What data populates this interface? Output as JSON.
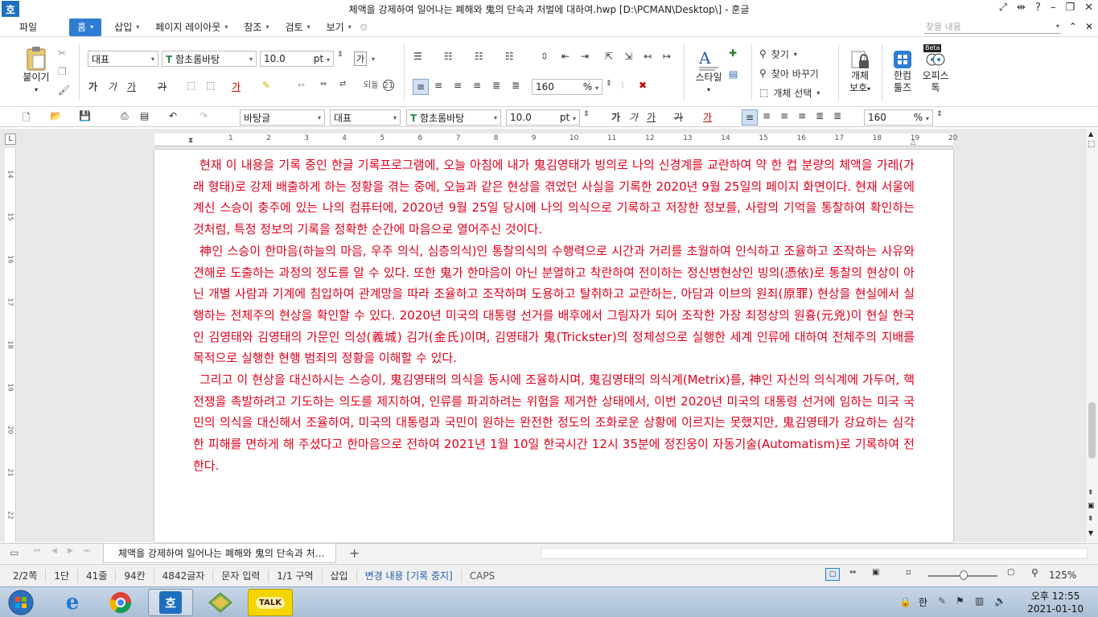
{
  "app": {
    "logo": "호",
    "title": "체액을 강제하여 일어나는 폐해와 鬼의 단속과 처벌에 대하여.hwp [D:\\PCMAN\\Desktop\\] - 훈글"
  },
  "menu": {
    "items": [
      "파일",
      "홈",
      "삽입",
      "페이지 레이아웃",
      "참조",
      "검토",
      "보기"
    ],
    "search_placeholder": "찾을 내용"
  },
  "ribbon": {
    "paste_label": "붙이기",
    "style_combo": "대표",
    "font_combo": "함초롬바탕",
    "size_combo": "10.0",
    "size_unit": "pt",
    "bold": "가",
    "italic": "가",
    "underline": "가",
    "strike": "가",
    "font_color": "가",
    "size_zoom": "160",
    "zoom_unit": "%",
    "style_label": "스타일",
    "find_label": "찾기",
    "replace_label": "찾아 바꾸기",
    "select_obj_label": "개체 선택",
    "protect_label_1": "개체",
    "protect_label_2": "보호",
    "hancom_tools_1": "한컴",
    "hancom_tools_2": "툴즈",
    "office_tok_1": "오피스",
    "office_tok_2": "톡",
    "beta_badge": "Beta",
    "para_combo_left": "가",
    "char_reset": "되돌",
    "char_count_circ": "21"
  },
  "toolbar2": {
    "para_style": "바탕글",
    "style": "대표",
    "font": "함초롬바탕",
    "size": "10.0",
    "size_unit": "pt",
    "zoom": "160",
    "zoom_unit": "%",
    "bold": "가",
    "italic": "가",
    "underline": "가",
    "strike": "가",
    "color": "가"
  },
  "ruler": {
    "numbers": [
      "1",
      "2",
      "3",
      "4",
      "5",
      "6",
      "7",
      "8",
      "9",
      "10",
      "11",
      "12",
      "13",
      "14",
      "15",
      "16",
      "17",
      "18",
      "19",
      "20"
    ],
    "vnumbers": [
      "14",
      "15",
      "16",
      "17",
      "18",
      "19",
      "20",
      "21",
      "22",
      "23"
    ]
  },
  "document": {
    "paragraphs": [
      "현재 이 내용을 기록 중인 한글 기록프로그램에, 오늘 아침에 내가 鬼김영태가 빙의로 나의 신경계를 교란하여 약 한 컵 분량의 체액을 가레(가래 형태)로 강제 배출하게 하는 정황을 겪는 중에, 오늘과 같은 현상을 겪었던 사실을 기록한 2020년 9월 25일의 페이지 화면이다. 현재 서울에 계신 스승이 충주에 있는 나의 컴퓨터에, 2020년 9월 25일 당시에 나의 의식으로 기록하고 저장한 정보를, 사람의 기억을 통찰하여 확인하는 것처럼, 특정 정보의 기록을 정확한 순간에 마음으로 열어주신 것이다.",
      "神인 스승이 한마음(하늘의 마음, 우주 의식, 심층의식)인 통찰의식의 수행력으로 시간과 거리를 초월하여 인식하고 조율하고 조작하는 사유와 견해로 도출하는 과정의 정도를 알 수 있다. 또한 鬼가 한마음이 아닌 분열하고 착란하여 전이하는 정신병현상인 빙의(憑依)로 통찰의 현상이 아닌 개별 사람과 기계에 침입하여 관계망을 따라 조율하고 조작하며 도용하고 탈취하고 교란하는, 아담과 이브의 원죄(原罪) 현상을 현실에서 실행하는 전체주의 현상을 확인할 수 있다. 2020년 미국의 대통령 선거를 배후에서 그림자가 되어 조작한 가장 최정상의 원흉(元兇)이 현실 한국인 김영태와 김영태의 가문인 의성(義城) 김가(金氏)이며, 김영태가 鬼(Trickster)의 정체성으로 실행한 세계 인류에 대하여 전체주의 지배를 목적으로 실행한 현행 범죄의 정황을 이해할 수 있다.",
      "그리고 이 현상을 대신하시는 스승이, 鬼김영태의 의식을 동시에 조율하시며, 鬼김영태의 의식계(Metrix)를, 神인 자신의 의식계에 가두어, 핵전쟁을 촉발하려고 기도하는 의도를 제지하여, 인류를 파괴하려는 위험을 제거한 상태에서, 이번 2020년 미국의 대통령 선거에 임하는 미국 국민의 의식을 대신해서 조율하여, 미국의 대통령과 국민이 원하는 완전한 정도의 조화로운 상황에 이르지는 못했지만, 鬼김영태가 강요하는 심각한 피해를 면하게 해 주셨다고 한마음으로 전하여 2021년 1월 10일 한국시간 12시 35분에 정진웅이 자동기술(Automatism)로 기록하여 전한다."
    ]
  },
  "tabs": {
    "doc_tab": "체액을 강제하여 일어나는 폐해와 鬼의 단속과 처…",
    "add": "+"
  },
  "status": {
    "page": "2/2쪽",
    "column": "1단",
    "line": "41줄",
    "col": "94칸",
    "chars": "4842글자",
    "mode": "문자 입력",
    "section": "1/1 구역",
    "insert": "삽입",
    "track": "변경 내용 [기록 중지]",
    "caps": "CAPS",
    "zoom": "125%"
  },
  "taskbar": {
    "kakao_label": "TALK",
    "hwp_logo": "호",
    "ime": "한",
    "time": "오후 12:55",
    "date": "2021-01-10"
  },
  "colors": {
    "doc_text": "#e0001b",
    "accent": "#2e7cd4"
  }
}
